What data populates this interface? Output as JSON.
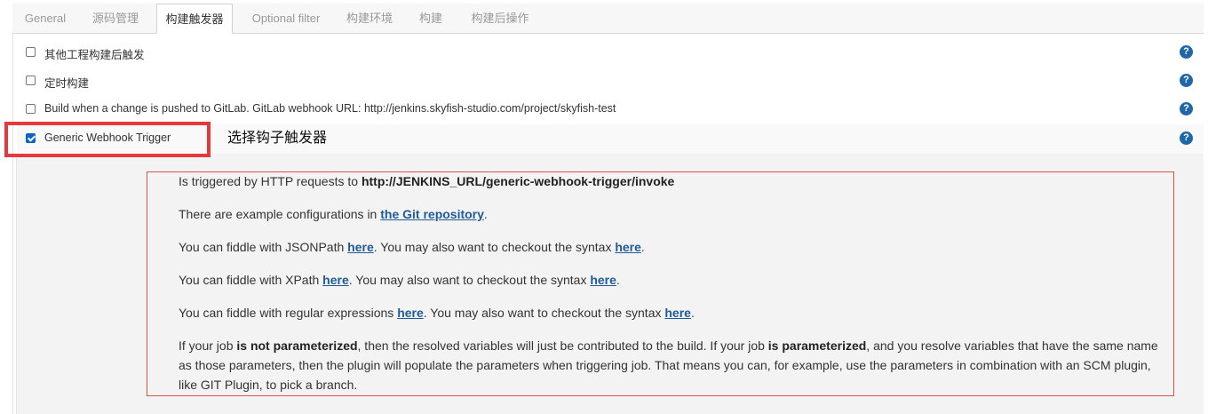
{
  "tabs": [
    {
      "label": "General"
    },
    {
      "label": "源码管理"
    },
    {
      "label": "构建触发器"
    },
    {
      "label": "Optional filter"
    },
    {
      "label": "构建环境"
    },
    {
      "label": "构建"
    },
    {
      "label": "构建后操作"
    }
  ],
  "active_tab": "构建触发器",
  "triggers": [
    {
      "label": "其他工程构建后触发",
      "checked": false
    },
    {
      "label": "定时构建",
      "checked": false
    },
    {
      "label": "Build when a change is pushed to GitLab. GitLab webhook URL: http://jenkins.skyfish-studio.com/project/skyfish-test",
      "checked": false
    },
    {
      "label": "Generic Webhook Trigger",
      "checked": true
    }
  ],
  "help_icon": "?",
  "annotation": "选择钩子触发器",
  "help": {
    "p1_prefix": "Is triggered by HTTP requests to ",
    "p1_url": "http://JENKINS_URL/generic-webhook-trigger/invoke",
    "p2_prefix": "There are example configurations in ",
    "p2_link": "the Git repository",
    "p2_suffix": ".",
    "p3_prefix": "You can fiddle with JSONPath ",
    "p3_link1": "here",
    "p3_mid": ". You may also want to checkout the syntax ",
    "p3_link2": "here",
    "p3_suffix": ".",
    "p4_prefix": "You can fiddle with XPath ",
    "p4_link1": "here",
    "p4_mid": ". You may also want to checkout the syntax ",
    "p4_link2": "here",
    "p4_suffix": ".",
    "p5_prefix": "You can fiddle with regular expressions ",
    "p5_link1": "here",
    "p5_mid": ". You may also want to checkout the syntax ",
    "p5_link2": "here",
    "p5_suffix": ".",
    "p6_a": "If your job ",
    "p6_b": "is not parameterized",
    "p6_c": ", then the resolved variables will just be contributed to the build. If your job ",
    "p6_d": "is parameterized",
    "p6_e": ", and you resolve variables that have the same name as those parameters, then the plugin will populate the parameters when triggering job. That means you can, for example, use the parameters in combination with an SCM plugin, like GIT Plugin, to pick a branch."
  },
  "colors": {
    "accent": "#1f67a6",
    "checkbox_checked": "#0a64c8",
    "highlight_red": "#e5393b"
  }
}
